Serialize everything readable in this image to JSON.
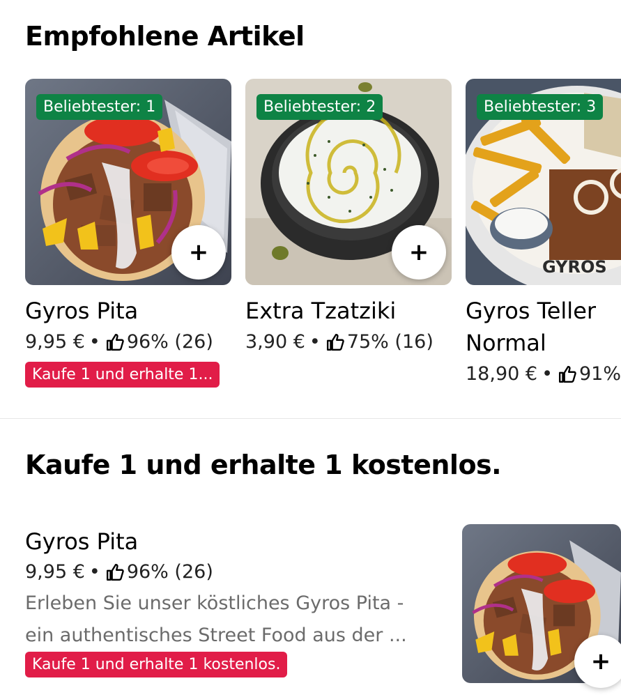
{
  "sections": {
    "recommended_title": "Empfohlene Artikel",
    "promo_title": "Kaufe 1 und erhalte 1 kostenlos."
  },
  "cards": [
    {
      "badge": "Beliebtester: 1",
      "name": "Gyros Pita",
      "price": "9,95 €",
      "sep": "•",
      "rating": "96% (26)",
      "promo": "Kaufe 1 und erhalte 1...",
      "add_label": "+"
    },
    {
      "badge": "Beliebtester: 2",
      "name": "Extra Tzatziki",
      "price": "3,90 €",
      "sep": "•",
      "rating": "75% (16)",
      "add_label": "+"
    },
    {
      "badge": "Beliebtester: 3",
      "name_line1": "Gyros Teller",
      "name_line2": "Normal",
      "price": "18,90 €",
      "sep": "•",
      "rating": "91%",
      "plate_text": "GYROS"
    }
  ],
  "list_item": {
    "name": "Gyros Pita",
    "price": "9,95 €",
    "sep": "•",
    "rating": "96% (26)",
    "desc_line1": "Erleben Sie unser köstliches Gyros Pita -",
    "desc_line2": "ein authentisches Street Food aus der ...",
    "promo": "Kaufe 1 und erhalte 1 kostenlos.",
    "add_label": "+"
  },
  "colors": {
    "badge_green": "#0e8345",
    "promo_red": "#e11d48",
    "text_secondary": "#6b6b6b"
  },
  "icons": [
    "thumbs-up-icon",
    "plus-icon"
  ]
}
